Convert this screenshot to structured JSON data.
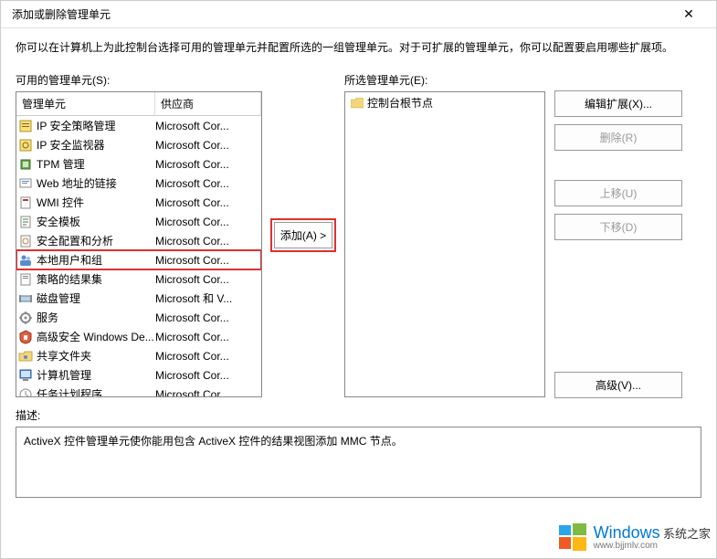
{
  "window": {
    "title": "添加或删除管理单元",
    "close_glyph": "✕"
  },
  "instruction": "你可以在计算机上为此控制台选择可用的管理单元并配置所选的一组管理单元。对于可扩展的管理单元，你可以配置要启用哪些扩展项。",
  "labels": {
    "available": "可用的管理单元(S):",
    "selected": "所选管理单元(E):",
    "col_name": "管理单元",
    "col_vendor": "供应商",
    "description": "描述:"
  },
  "available_list": [
    {
      "name": "IP 安全策略管理",
      "vendor": "Microsoft Cor...",
      "icon": "policy"
    },
    {
      "name": "IP 安全监视器",
      "vendor": "Microsoft Cor...",
      "icon": "monitor"
    },
    {
      "name": "TPM 管理",
      "vendor": "Microsoft Cor...",
      "icon": "tpm"
    },
    {
      "name": "Web 地址的链接",
      "vendor": "Microsoft Cor...",
      "icon": "link"
    },
    {
      "name": "WMI 控件",
      "vendor": "Microsoft Cor...",
      "icon": "wmi"
    },
    {
      "name": "安全模板",
      "vendor": "Microsoft Cor...",
      "icon": "template"
    },
    {
      "name": "安全配置和分析",
      "vendor": "Microsoft Cor...",
      "icon": "config"
    },
    {
      "name": "本地用户和组",
      "vendor": "Microsoft Cor...",
      "icon": "users",
      "highlighted": true
    },
    {
      "name": "策略的结果集",
      "vendor": "Microsoft Cor...",
      "icon": "rsop"
    },
    {
      "name": "磁盘管理",
      "vendor": "Microsoft 和 V...",
      "icon": "disk"
    },
    {
      "name": "服务",
      "vendor": "Microsoft Cor...",
      "icon": "services"
    },
    {
      "name": "高级安全 Windows De...",
      "vendor": "Microsoft Cor...",
      "icon": "firewall"
    },
    {
      "name": "共享文件夹",
      "vendor": "Microsoft Cor...",
      "icon": "share"
    },
    {
      "name": "计算机管理",
      "vendor": "Microsoft Cor...",
      "icon": "computer"
    },
    {
      "name": "任务计划程序",
      "vendor": "Microsoft Cor...",
      "icon": "task"
    }
  ],
  "selected_tree": {
    "root": "控制台根节点"
  },
  "buttons": {
    "add": "添加(A) >",
    "edit_ext": "编辑扩展(X)...",
    "remove": "删除(R)",
    "move_up": "上移(U)",
    "move_down": "下移(D)",
    "advanced": "高级(V)..."
  },
  "description_text": "ActiveX 控件管理单元使你能用包含 ActiveX 控件的结果视图添加 MMC 节点。",
  "watermark": {
    "brand1": "Windows",
    "brand2": "系统之家",
    "url": "www.bjjmlv.com"
  }
}
